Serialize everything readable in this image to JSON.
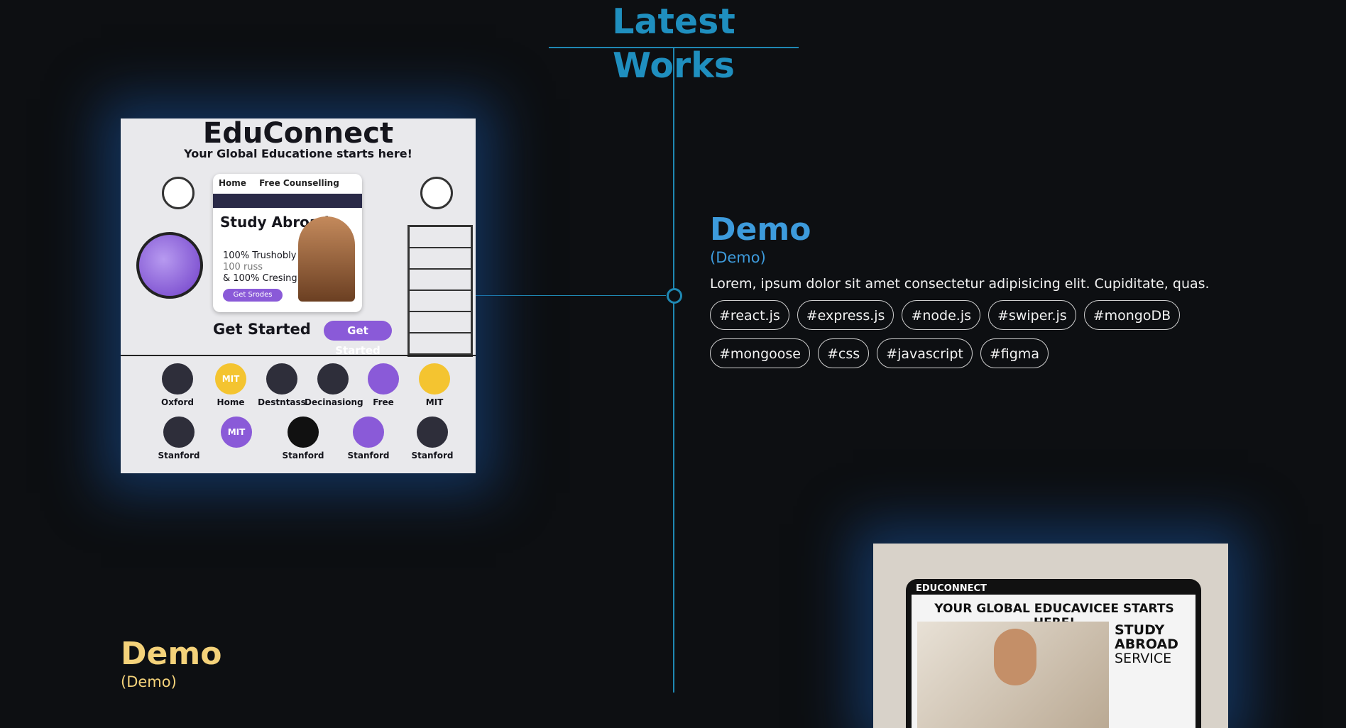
{
  "section": {
    "title": "Latest Works"
  },
  "projects": [
    {
      "title": "Demo",
      "subtitle": "(Demo)",
      "description": "Lorem, ipsum dolor sit amet consectetur adipisicing elit. Cupiditate, quas.",
      "tags": [
        "#react.js",
        "#express.js",
        "#node.js",
        "#swiper.js",
        "#mongoDB",
        "#mongoose",
        "#css",
        "#javascript",
        "#figma"
      ],
      "accent": "#3d9bdc",
      "thumbnail": {
        "brand": "EduConnect",
        "tagline": "Your Global Educatione starts here!",
        "nav": [
          "Home",
          "Free Counselling"
        ],
        "hero": "Study Abroad",
        "hero_lines": [
          "100% Trushobly",
          "100 russ",
          "& 100% Cresing!"
        ],
        "hero_button": "Get Srodes",
        "cta": "Get Started",
        "cta_button": "Get Started",
        "icons": [
          {
            "label": "Oxford",
            "color": "#2e2e3a"
          },
          {
            "label": "Home",
            "color": "#f4c430",
            "text": "MIT"
          },
          {
            "label": "Destntass",
            "color": "#2e2e3a"
          },
          {
            "label": "Decinasiong",
            "color": "#2e2e3a"
          },
          {
            "label": "Free",
            "color": "#8a5ad8"
          },
          {
            "label": "MIT",
            "color": "#f4c430"
          },
          {
            "label": "Stanford",
            "color": "#2e2e3a"
          },
          {
            "label": "",
            "color": "#8a5ad8",
            "text": "MIT"
          },
          {
            "label": "Stanford",
            "color": "#111111"
          },
          {
            "label": "Stanford",
            "color": "#8a5ad8"
          },
          {
            "label": "Stanford",
            "color": "#2e2e3a"
          }
        ]
      }
    },
    {
      "title": "Demo",
      "subtitle": "(Demo)",
      "accent": "#f4d27a",
      "thumbnail": {
        "brand": "EDUCONNECT",
        "headline": "YOUR GLOBAL EDUCAVICEE STARTS HERE!",
        "side_text": [
          "STUDY",
          "ABROAD",
          "SERVICE"
        ]
      }
    }
  ],
  "colors": {
    "background": "#0d0f12",
    "timeline": "#1f88b3"
  }
}
